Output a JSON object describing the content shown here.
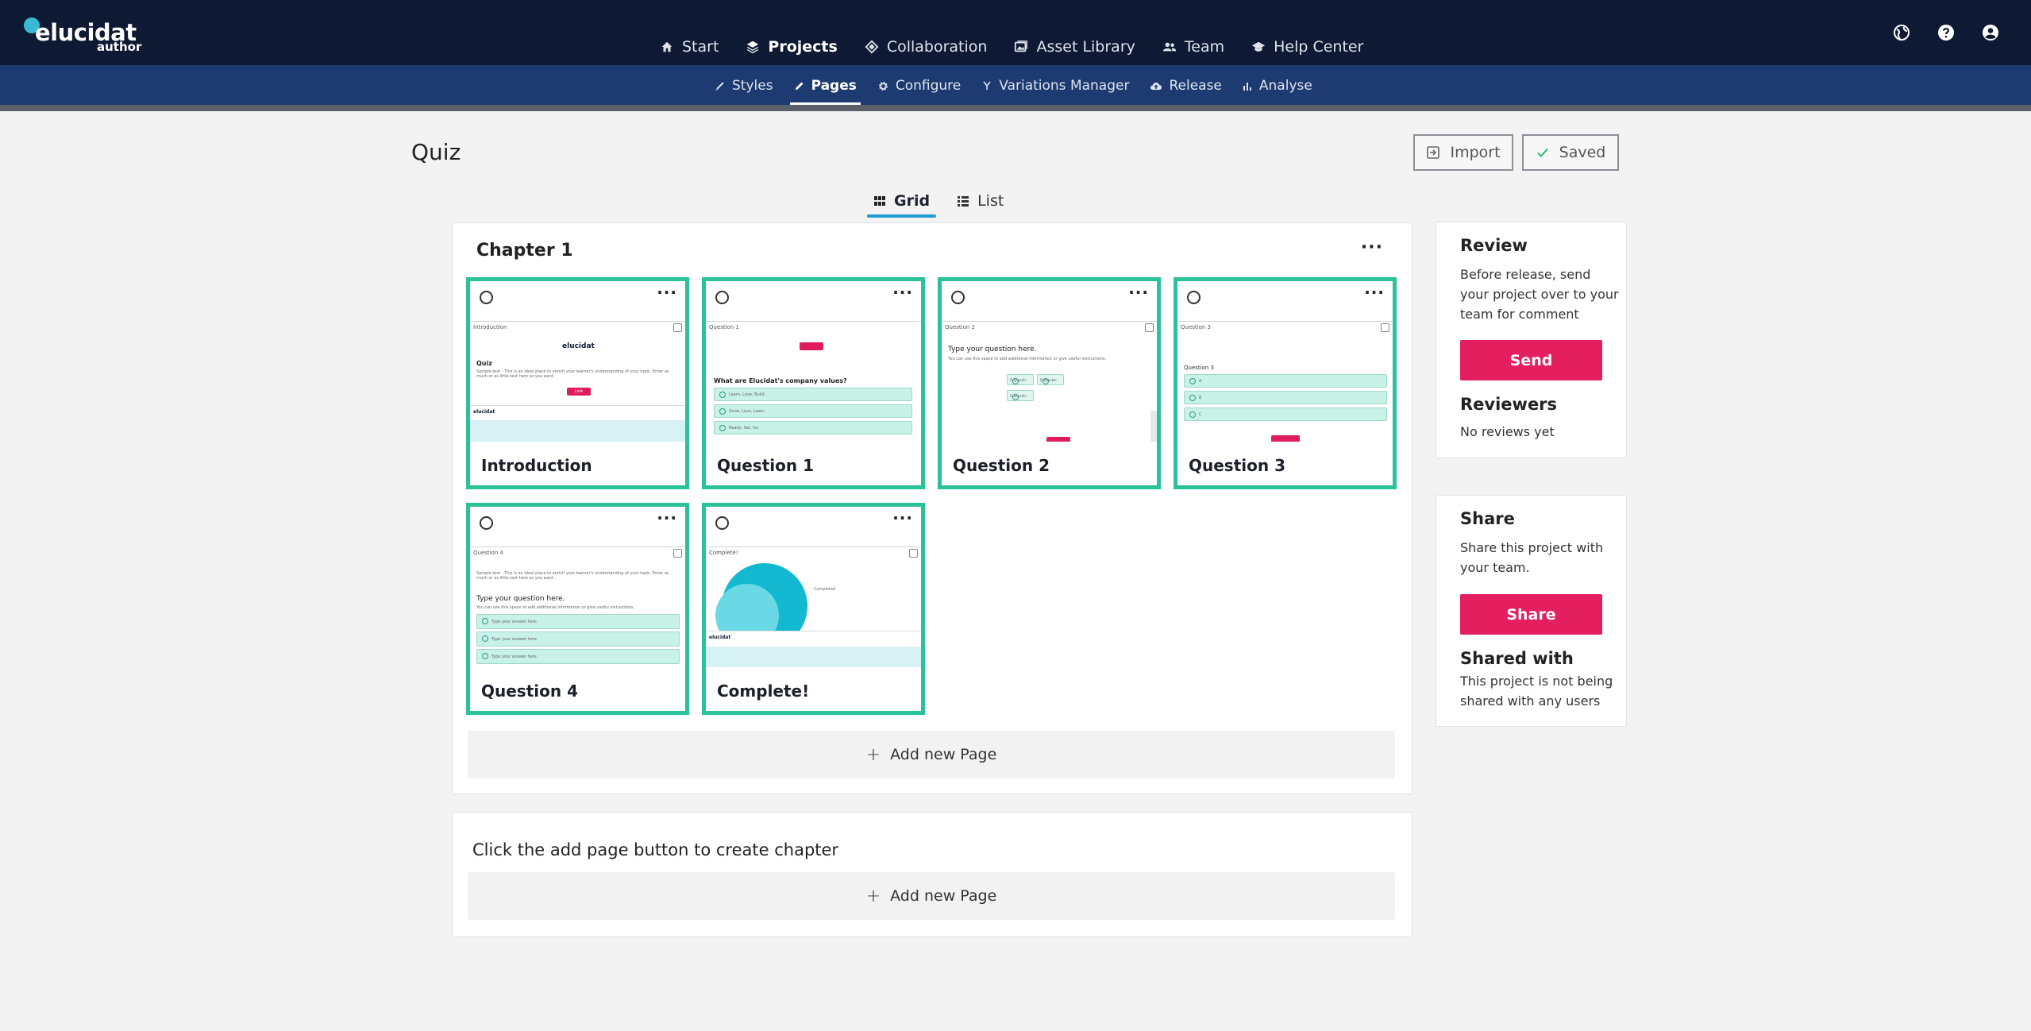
{
  "app": {
    "logo_name": "elucidat",
    "logo_sub": "author",
    "main_nav": [
      {
        "label": "Start",
        "icon": "home-icon"
      },
      {
        "label": "Projects",
        "icon": "layers-icon",
        "active": true
      },
      {
        "label": "Collaboration",
        "icon": "diamond-icon"
      },
      {
        "label": "Asset Library",
        "icon": "images-icon"
      },
      {
        "label": "Team",
        "icon": "people-icon"
      },
      {
        "label": "Help Center",
        "icon": "graduation-cap-icon"
      }
    ],
    "top_icons": [
      "globe-icon",
      "help-icon",
      "account-icon"
    ],
    "sub_nav": [
      {
        "label": "Styles",
        "icon": "brush-icon"
      },
      {
        "label": "Pages",
        "icon": "pencil-icon",
        "active": true
      },
      {
        "label": "Configure",
        "icon": "gear-icon"
      },
      {
        "label": "Variations Manager",
        "icon": "branch-icon"
      },
      {
        "label": "Release",
        "icon": "cloud-upload-icon"
      },
      {
        "label": "Analyse",
        "icon": "bar-chart-icon"
      }
    ]
  },
  "page": {
    "title": "Quiz",
    "import_label": "Import",
    "saved_label": "Saved",
    "view_tabs": {
      "grid": "Grid",
      "list": "List"
    }
  },
  "chapter1": {
    "title": "Chapter 1",
    "pages": [
      {
        "name": "Introduction",
        "thumb_label": "Introduction"
      },
      {
        "name": "Question 1",
        "thumb_label": "Question 1"
      },
      {
        "name": "Question 2",
        "thumb_label": "Question 2"
      },
      {
        "name": "Question 3",
        "thumb_label": "Question 3"
      },
      {
        "name": "Question 4",
        "thumb_label": "Question 4"
      },
      {
        "name": "Complete!",
        "thumb_label": "Complete!"
      }
    ],
    "add_page_label": "Add new Page"
  },
  "chapter2": {
    "hint": "Click the add page button to create chapter",
    "add_page_label": "Add new Page"
  },
  "thumbs": {
    "intro_title": "Quiz",
    "intro_logo": "elucidat",
    "intro_body": "Sample text - This is an ideal place to enrich your learner's understanding of your topic. Enter as much or as little text here as you want.",
    "intro_btn": "Link",
    "q1_question": "What are Elucidat's company values?",
    "q1_options": [
      "Learn, Love, Build",
      "Grow, Love, Learn",
      "Ready, Set, Go"
    ],
    "q2_question": "Type your question here.",
    "q2_sub": "You can use this space to add additional information or give useful instructions.",
    "q2_chips": [
      "Droppable",
      "Droppable",
      "Droppable"
    ],
    "q3_heading": "Question 3",
    "q3_options": [
      "A",
      "B",
      "C"
    ],
    "q4_body": "Sample text - This is an ideal place to enrich your learner's understanding of your topic. Enter as much or as little text here as you want.",
    "q4_question": "Type your question here.",
    "q4_sub": "You can use this space to add additional information or give useful instructions.",
    "q4_options": [
      "Type your answer here",
      "Type your answer here",
      "Type your answer here"
    ],
    "complete_text": "Completed"
  },
  "review": {
    "heading": "Review",
    "text": "Before release, send your project over to your team for comment",
    "send_label": "Send",
    "reviewers_heading": "Reviewers",
    "reviewers_text": "No reviews yet"
  },
  "share": {
    "heading": "Share",
    "text": "Share this project with your team.",
    "share_label": "Share",
    "shared_with_heading": "Shared with",
    "shared_with_text": "This project is not being shared with any users"
  },
  "colors": {
    "topbar": "#0e1a33",
    "subbar": "#1d3b70",
    "card_border": "#2bc29a",
    "accent_pink": "#e41f60",
    "tab_underline": "#1f9bd2"
  }
}
